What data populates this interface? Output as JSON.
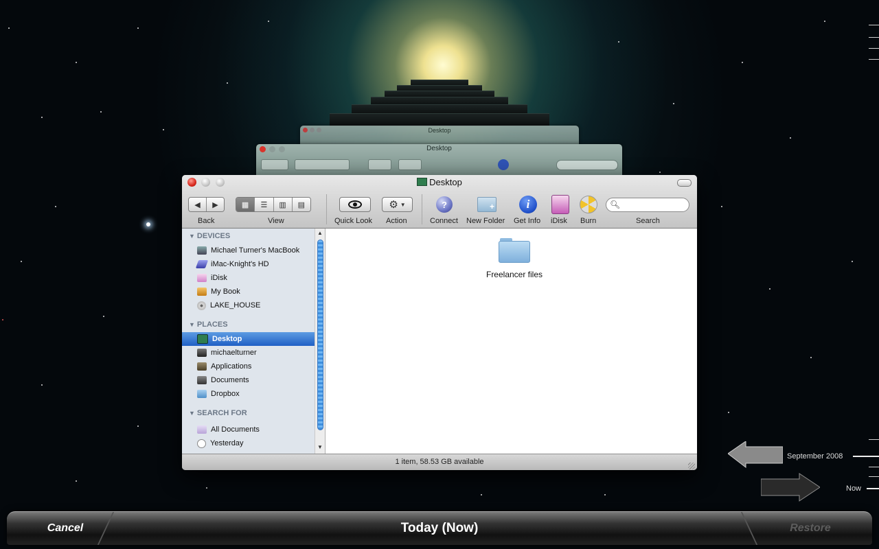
{
  "window": {
    "title": "Desktop",
    "background_title": "Desktop",
    "toolbar": {
      "back_label": "Back",
      "view_label": "View",
      "quicklook_label": "Quick Look",
      "action_label": "Action",
      "connect_label": "Connect",
      "new_folder_label": "New Folder",
      "get_info_label": "Get Info",
      "idisk_label": "iDisk",
      "burn_label": "Burn",
      "search_label": "Search",
      "search_value": ""
    },
    "sidebar": {
      "devices_header": "DEVICES",
      "devices": [
        {
          "label": "Michael Turner's MacBook",
          "icon": "laptop-icon"
        },
        {
          "label": "iMac-Knight's HD",
          "icon": "drive-icon"
        },
        {
          "label": "iDisk",
          "icon": "idisk-icon"
        },
        {
          "label": "My Book",
          "icon": "external-drive-icon"
        },
        {
          "label": "LAKE_HOUSE",
          "icon": "disc-icon"
        }
      ],
      "places_header": "PLACES",
      "places": [
        {
          "label": "Desktop",
          "icon": "desktop-icon",
          "selected": true
        },
        {
          "label": "michaelturner",
          "icon": "home-icon"
        },
        {
          "label": "Applications",
          "icon": "applications-icon"
        },
        {
          "label": "Documents",
          "icon": "documents-icon"
        },
        {
          "label": "Dropbox",
          "icon": "dropbox-folder-icon"
        }
      ],
      "search_header": "SEARCH FOR",
      "search_items": [
        {
          "label": "All Documents",
          "icon": "smart-folder-icon"
        },
        {
          "label": "Yesterday",
          "icon": "clock-icon"
        }
      ]
    },
    "content": {
      "items": [
        {
          "label": "Freelancer files",
          "icon": "folder-icon"
        }
      ]
    },
    "status": "1 item, 58.53 GB available"
  },
  "time_machine": {
    "cancel_label": "Cancel",
    "center_label": "Today (Now)",
    "restore_label": "Restore",
    "timeline": {
      "date_label": "September 2008",
      "now_label": "Now"
    }
  },
  "colors": {
    "selection": "#3a7bd5",
    "sidebar_bg": "#dfe5ec",
    "close": "#e0413a"
  }
}
